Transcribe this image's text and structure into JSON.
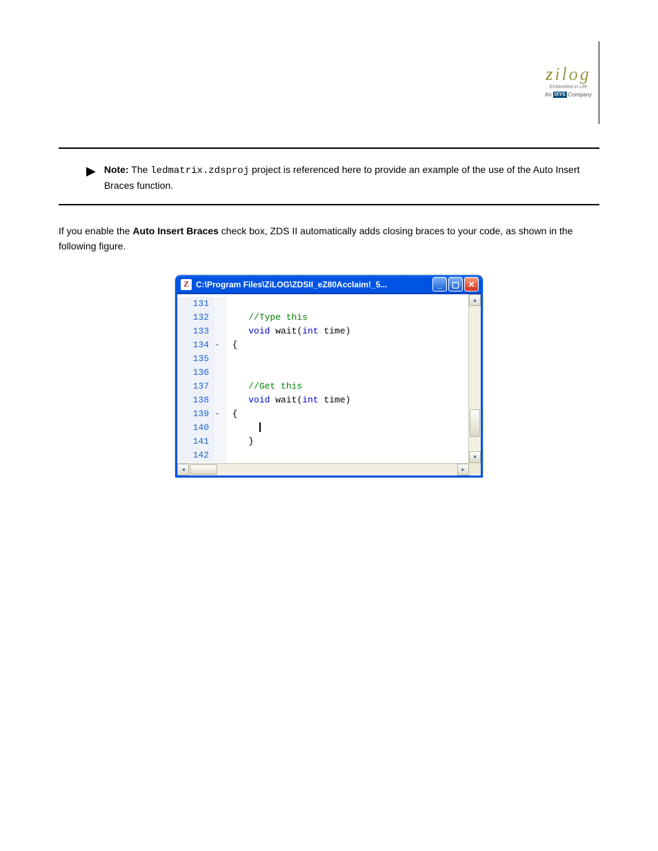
{
  "logo": {
    "brand_z": "z",
    "brand_rest": "ilog",
    "tagline": "Embedded in Life",
    "prefix": "An",
    "ixys": "IXYS",
    "suffix": "Company"
  },
  "note": {
    "label": "Note:",
    "text_before": "The ",
    "code": "ledmatrix.zdsproj",
    "text_after": " project is referenced here to provide an example of the use of the Auto Insert Braces function."
  },
  "paragraph": {
    "text_before": "If you enable the ",
    "bold": "Auto Insert Braces",
    "text_after": " check box, ZDS II automatically adds closing braces to your code, as shown in the following figure."
  },
  "window": {
    "title": "C:\\Program Files\\ZiLOG\\ZDSII_eZ80Acclaim!_5...",
    "icon_letter": "Z"
  },
  "code": {
    "lines": [
      {
        "no": "131",
        "fold": "",
        "segs": []
      },
      {
        "no": "132",
        "fold": "",
        "segs": [
          {
            "t": "    ",
            "c": ""
          },
          {
            "t": "//Type this",
            "c": "cm"
          }
        ]
      },
      {
        "no": "133",
        "fold": "",
        "segs": [
          {
            "t": "    ",
            "c": ""
          },
          {
            "t": "void",
            "c": "kw"
          },
          {
            "t": " wait(",
            "c": ""
          },
          {
            "t": "int",
            "c": "kw"
          },
          {
            "t": " time)",
            "c": ""
          }
        ]
      },
      {
        "no": "134",
        "fold": "-",
        "segs": [
          {
            "t": " {",
            "c": ""
          }
        ]
      },
      {
        "no": "135",
        "fold": "",
        "segs": []
      },
      {
        "no": "136",
        "fold": "",
        "segs": []
      },
      {
        "no": "137",
        "fold": "",
        "segs": [
          {
            "t": "    ",
            "c": ""
          },
          {
            "t": "//Get this",
            "c": "cm"
          }
        ]
      },
      {
        "no": "138",
        "fold": "",
        "segs": [
          {
            "t": "    ",
            "c": ""
          },
          {
            "t": "void",
            "c": "kw"
          },
          {
            "t": " wait(",
            "c": ""
          },
          {
            "t": "int",
            "c": "kw"
          },
          {
            "t": " time)",
            "c": ""
          }
        ]
      },
      {
        "no": "139",
        "fold": "-",
        "segs": [
          {
            "t": " {",
            "c": ""
          }
        ]
      },
      {
        "no": "140",
        "fold": "",
        "segs": [
          {
            "t": "      ",
            "c": ""
          }
        ],
        "cursor": true
      },
      {
        "no": "141",
        "fold": "",
        "segs": [
          {
            "t": "    }",
            "c": ""
          }
        ]
      },
      {
        "no": "142",
        "fold": "",
        "segs": []
      }
    ]
  },
  "scroll": {
    "up": "▴",
    "down": "▾",
    "left": "◂",
    "right": "▸"
  }
}
